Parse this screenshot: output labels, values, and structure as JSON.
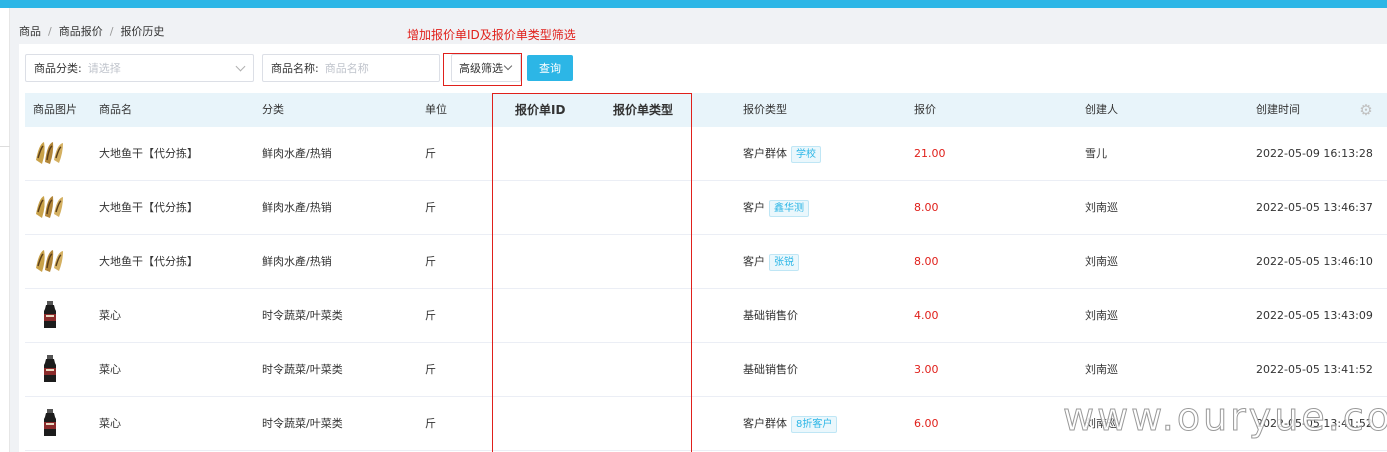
{
  "breadcrumb": [
    "商品",
    "商品报价",
    "报价历史"
  ],
  "annotation": "增加报价单ID及报价单类型筛选",
  "filters": {
    "category_label": "商品分类:",
    "category_placeholder": "请选择",
    "name_label": "商品名称:",
    "name_placeholder": "商品名称",
    "advanced_label": "高级筛选",
    "query_label": "查询"
  },
  "columns": {
    "image": "商品图片",
    "name": "商品名",
    "category": "分类",
    "unit": "单位",
    "quote_id": "报价单ID",
    "quote_type": "报价单类型",
    "price_type": "报价类型",
    "price": "报价",
    "creator": "创建人",
    "created_at": "创建时间"
  },
  "rows": [
    {
      "image": "dried-fish-icon",
      "name": "大地鱼干【代分拣】",
      "category": "鲜肉水產/热销",
      "unit": "斤",
      "price_type": "客户群体",
      "tag": "学校",
      "price": "21.00",
      "creator": "雪儿",
      "created_at": "2022-05-09 16:13:28"
    },
    {
      "image": "dried-fish-icon",
      "name": "大地鱼干【代分拣】",
      "category": "鲜肉水產/热销",
      "unit": "斤",
      "price_type": "客户",
      "tag": "鑫华测",
      "price": "8.00",
      "creator": "刘南巡",
      "created_at": "2022-05-05 13:46:37"
    },
    {
      "image": "dried-fish-icon",
      "name": "大地鱼干【代分拣】",
      "category": "鲜肉水產/热销",
      "unit": "斤",
      "price_type": "客户",
      "tag": "张锐",
      "price": "8.00",
      "creator": "刘南巡",
      "created_at": "2022-05-05 13:46:10"
    },
    {
      "image": "bottle-icon",
      "name": "菜心",
      "category": "时令蔬菜/叶菜类",
      "unit": "斤",
      "price_type": "基础销售价",
      "tag": "",
      "price": "4.00",
      "creator": "刘南巡",
      "created_at": "2022-05-05 13:43:09"
    },
    {
      "image": "bottle-icon",
      "name": "菜心",
      "category": "时令蔬菜/叶菜类",
      "unit": "斤",
      "price_type": "基础销售价",
      "tag": "",
      "price": "3.00",
      "creator": "刘南巡",
      "created_at": "2022-05-05 13:41:52"
    },
    {
      "image": "bottle-icon",
      "name": "菜心",
      "category": "时令蔬菜/叶菜类",
      "unit": "斤",
      "price_type": "客户群体",
      "tag": "8折客户",
      "price": "6.00",
      "creator": "刘南巡",
      "created_at": "2022-05-05 13:41:52"
    }
  ],
  "watermark": "www.ouryue.com",
  "colors": {
    "accent": "#2cb6e6",
    "price": "#e0201b",
    "annotation": "#e0201b",
    "header_bg": "#e8f4fa"
  }
}
